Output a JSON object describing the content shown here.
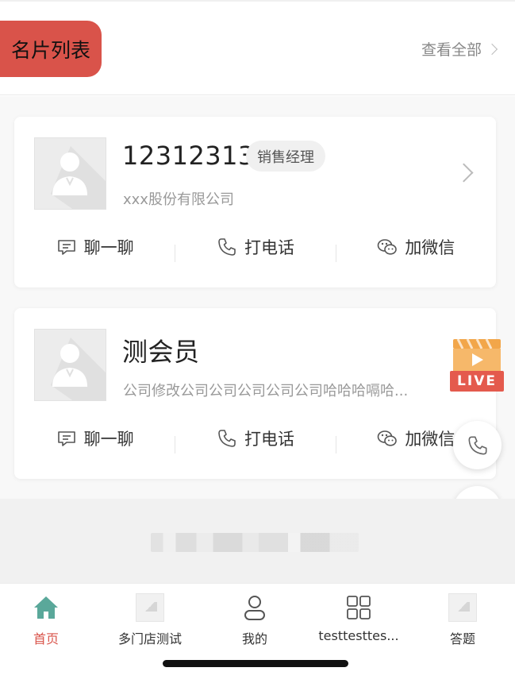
{
  "header": {
    "title": "名片列表",
    "view_all": "查看全部"
  },
  "cards": [
    {
      "name": "12312313",
      "badge": "销售经理",
      "company": "xxx股份有限公司",
      "actions": {
        "chat": "聊一聊",
        "call": "打电话",
        "wechat": "加微信"
      }
    },
    {
      "name": "测会员",
      "badge": "",
      "company": "公司修改公司公司公司公司公司哈哈哈嗝哈...",
      "actions": {
        "chat": "聊一聊",
        "call": "打电话",
        "wechat": "加微信"
      }
    }
  ],
  "live_badge": "LIVE",
  "tabbar": {
    "items": [
      {
        "label": "首页",
        "icon": "home-icon",
        "active": true
      },
      {
        "label": "多门店测试",
        "icon": "image-placeholder-icon",
        "active": false
      },
      {
        "label": "我的",
        "icon": "user-icon",
        "active": false
      },
      {
        "label": "testtesttes...",
        "icon": "grid-icon",
        "active": false
      },
      {
        "label": "答题",
        "icon": "image-placeholder-icon",
        "active": false
      }
    ]
  },
  "colors": {
    "accent": "#d9534a",
    "home_icon": "#5aa89a",
    "live": "#e45a4d"
  }
}
